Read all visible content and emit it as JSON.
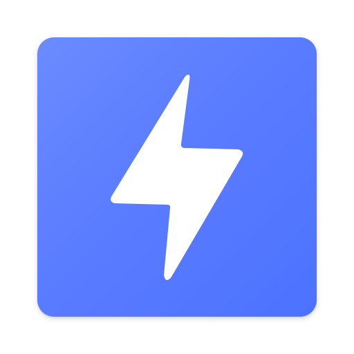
{
  "app_icon": {
    "icon_name": "lightning-bolt-icon",
    "background_color_start": "#6b8bff",
    "background_color_end": "#4c72ff",
    "glyph_color": "#ffffff"
  }
}
